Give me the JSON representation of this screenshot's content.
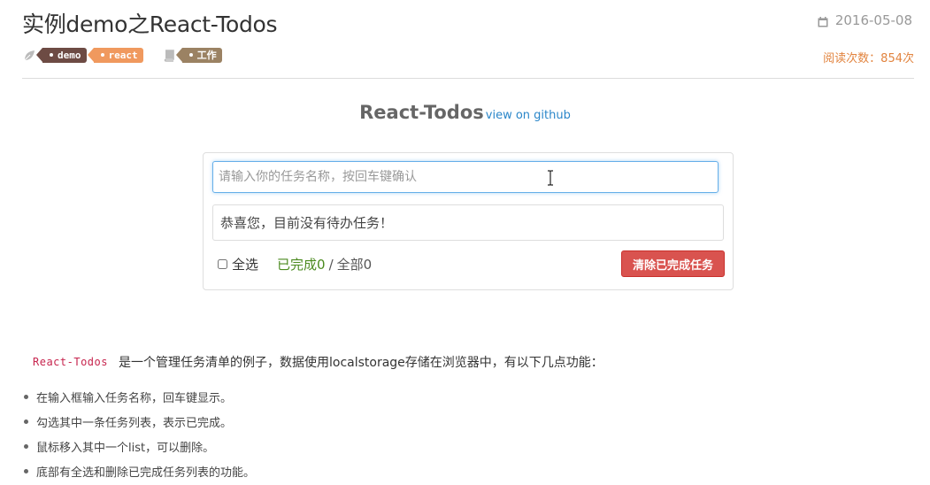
{
  "post": {
    "title": "实例demo之React-Todos",
    "date": "2016-05-08",
    "tags": [
      "demo",
      "react"
    ],
    "category": "工作",
    "views": "阅读次数：854次"
  },
  "app": {
    "title": "React-Todos",
    "github_link": "view on github",
    "input_placeholder": "请输入你的任务名称，按回车键确认",
    "empty_message": "恭喜您，目前没有待办任务！",
    "select_all_label": "全选",
    "done_label": "已完成",
    "done_count": "0",
    "separator": "/",
    "all_label": "全部",
    "all_count": "0",
    "clear_button": "清除已完成任务"
  },
  "description": {
    "code": "React-Todos",
    "text": "是一个管理任务清单的例子，数据使用localstorage存储在浏览器中，有以下几点功能："
  },
  "features": [
    "在输入框输入任务名称，回车键显示。",
    "勾选其中一条任务列表，表示已完成。",
    "鼠标移入其中一个list，可以删除。",
    "底部有全选和删除已完成任务列表的功能。"
  ],
  "colors": {
    "accent_link": "#2a86c9",
    "danger": "#d9534f",
    "done_green": "#4b8a1f",
    "views_orange": "#e2843f"
  }
}
